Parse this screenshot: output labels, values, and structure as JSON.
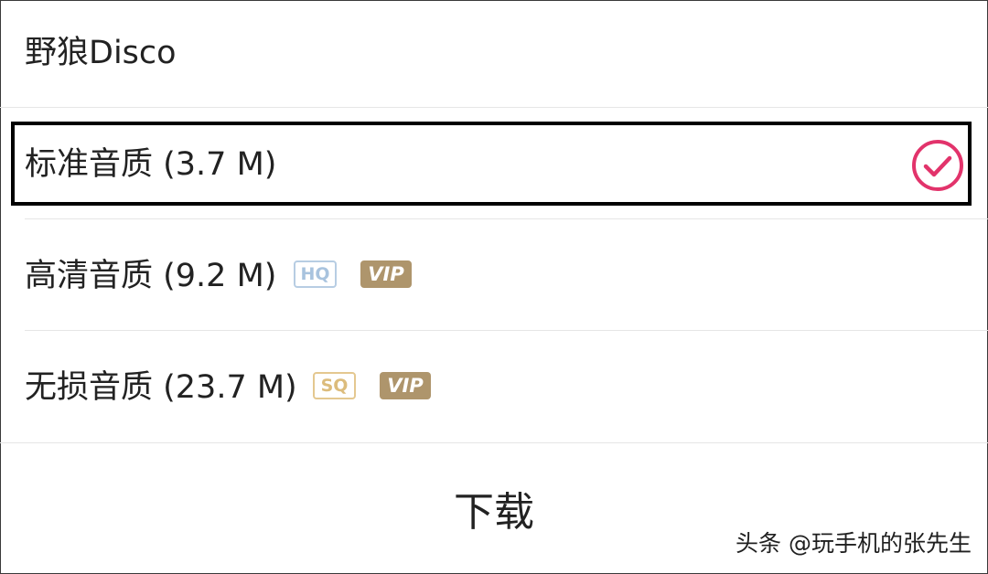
{
  "song": {
    "title": "野狼Disco"
  },
  "options": [
    {
      "label": "标准音质 (3.7 M)",
      "selected": true,
      "icon": "check-circle-icon"
    },
    {
      "label": "高清音质 (9.2 M)",
      "quality_badge": "HQ",
      "vip_badge": "VIP",
      "selected": false
    },
    {
      "label": "无损音质 (23.7 M)",
      "quality_badge": "SQ",
      "vip_badge": "VIP",
      "selected": false
    }
  ],
  "download": {
    "label": "下载"
  },
  "watermark": {
    "text": "头条 @玩手机的张先生"
  },
  "colors": {
    "check": "#e2336b",
    "hq_badge": "#a8c3de",
    "sq_badge": "#dcbc7c",
    "vip_badge": "#ae956c"
  }
}
